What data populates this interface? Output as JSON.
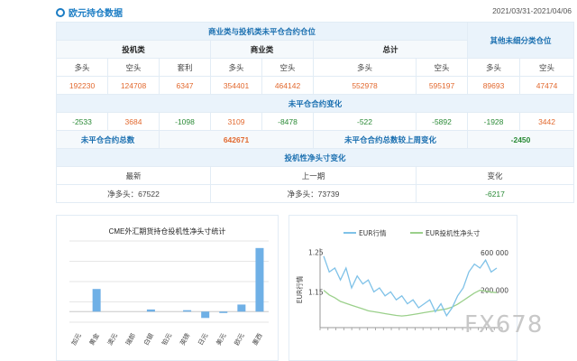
{
  "header": {
    "title": "欧元持仓数据",
    "date_range": "2021/03/31-2021/04/06"
  },
  "table": {
    "noncommercial_title": "商业类与投机类未平仓合约仓位",
    "other_title": "其他未细分类仓位",
    "groups": [
      "投机类",
      "商业类",
      "总计"
    ],
    "sub_headers": [
      "多头",
      "空头",
      "套利",
      "多头",
      "空头",
      "多头",
      "空头",
      "多头",
      "空头"
    ],
    "values": [
      "192230",
      "124708",
      "6347",
      "354401",
      "464142",
      "552978",
      "595197",
      "89693",
      "47474"
    ],
    "change_title": "未平仓合约变化",
    "changes": [
      "-2533",
      "3684",
      "-1098",
      "3109",
      "-8478",
      "-522",
      "-5892",
      "-1928",
      "3442"
    ],
    "oi_total_label": "未平仓合约总数",
    "oi_total_value": "642671",
    "oi_change_label": "未平仓合约总数较上周变化",
    "oi_change_value": "-2450",
    "spec_title": "投机性净头寸变化",
    "spec_headers": [
      "最新",
      "上一期",
      "变化"
    ],
    "spec_values": [
      "净多头：67522",
      "净多头：73739",
      "-6217"
    ]
  },
  "colors": {
    "accent": "#1a7cc4",
    "orange": "#e2692f",
    "green": "#2a8a36",
    "bar": "#6fb0e6",
    "eur_line": "#7fc2e8",
    "net_line": "#9bd08b"
  },
  "chart_data": [
    {
      "type": "bar",
      "title": "CME外汇期货持仓投机性净头寸统计",
      "categories": [
        "加元",
        "黄金",
        "澳元",
        "瑞郎",
        "白银",
        "铂元",
        "英镑",
        "日元",
        "美元",
        "欧元",
        "墨西"
      ],
      "values": [
        0,
        0.32,
        0,
        0,
        0.03,
        0,
        0.02,
        -0.09,
        -0.02,
        0.1,
        0.9
      ],
      "ylim": [
        -0.15,
        1.0
      ],
      "grid": true
    },
    {
      "type": "line",
      "legend": [
        "EUR行情",
        "EUR投机性净头寸"
      ],
      "legend_position": "top",
      "ylabel_left": "EUR行情",
      "left_ticks": [
        "1.25",
        "1.15"
      ],
      "right_ticks": [
        "600 000",
        "200 000"
      ],
      "ylim_left": [
        1.06,
        1.26
      ],
      "ylim_right": [
        -200000,
        650000
      ],
      "series": [
        {
          "name": "EUR行情",
          "values": [
            1.24,
            1.2,
            1.21,
            1.18,
            1.21,
            1.16,
            1.19,
            1.17,
            1.18,
            1.15,
            1.16,
            1.14,
            1.15,
            1.13,
            1.14,
            1.12,
            1.13,
            1.11,
            1.12,
            1.13,
            1.1,
            1.12,
            1.09,
            1.11,
            1.14,
            1.16,
            1.2,
            1.22,
            1.21,
            1.23,
            1.2,
            1.21
          ]
        },
        {
          "name": "EUR投机性净头寸",
          "values": [
            200000,
            150000,
            120000,
            80000,
            60000,
            40000,
            20000,
            0,
            -20000,
            -30000,
            -40000,
            -50000,
            -60000,
            -70000,
            -75000,
            -70000,
            -60000,
            -50000,
            -40000,
            -30000,
            -20000,
            -10000,
            0,
            20000,
            50000,
            90000,
            130000,
            170000,
            200000,
            190000,
            180000,
            175000
          ]
        }
      ]
    }
  ],
  "watermark": "FX678"
}
